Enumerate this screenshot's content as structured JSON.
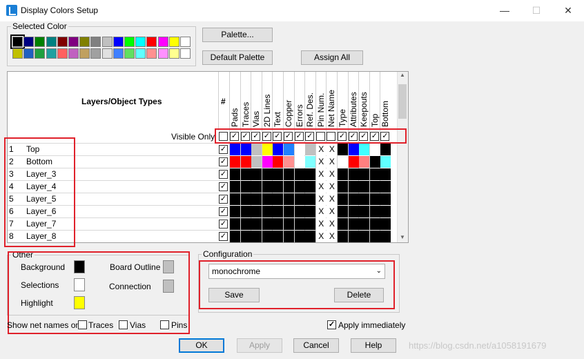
{
  "window": {
    "title": "Display Colors Setup",
    "minimize": "—",
    "maximize": "☐",
    "close": "✕"
  },
  "selected_color": {
    "label": "Selected Color",
    "row1": [
      "#000000",
      "#000080",
      "#008000",
      "#008080",
      "#800000",
      "#800080",
      "#808000",
      "#808080",
      "#c0c0c0",
      "#0000ff",
      "#00ff00",
      "#00ffff",
      "#ff0000",
      "#ff00ff",
      "#ffff00",
      "#ffffff"
    ],
    "row2": [
      "#c0c000",
      "#2060c0",
      "#20a040",
      "#20a0a0",
      "#ff6060",
      "#c060c0",
      "#c0a060",
      "#a0a0a0",
      "#e0e0e0",
      "#4080ff",
      "#60e060",
      "#60ffff",
      "#ff9090",
      "#ff90ff",
      "#ffff90",
      "#ffffff"
    ]
  },
  "buttons": {
    "palette": "Palette...",
    "default_palette": "Default Palette",
    "assign_all": "Assign All",
    "ok": "OK",
    "apply": "Apply",
    "cancel": "Cancel",
    "help": "Help",
    "save": "Save",
    "delete": "Delete"
  },
  "grid": {
    "header_title": "Layers/Object Types",
    "hash": "#",
    "visible_only": "Visible Only",
    "columns": [
      "Pads",
      "Traces",
      "Vias",
      "2D Lines",
      "Text",
      "Copper",
      "Errors",
      "Ref. Des.",
      "Pin Num.",
      "Net Name",
      "Type",
      "Attributes",
      "Keepouts",
      "Top",
      "Bottom"
    ],
    "visible_checks": [
      true,
      true,
      true,
      true,
      true,
      true,
      true,
      true,
      false,
      false,
      true,
      true,
      true,
      true,
      true
    ],
    "rows": [
      {
        "num": "1",
        "name": "Top",
        "colors": [
          "#0000ff",
          "#0000ff",
          "#c0c0c0",
          "#ffff00",
          "#0000ff",
          "#2080ff",
          "#ffffff",
          "#c0c0c0",
          "X",
          "X",
          "#000000",
          "#0000ff",
          "#40ffff",
          "#ffffff",
          "#000000"
        ]
      },
      {
        "num": "2",
        "name": "Bottom",
        "colors": [
          "#ff0000",
          "#ff0000",
          "#c0c0c0",
          "#ff00ff",
          "#ff0000",
          "#ff9090",
          "#ffffff",
          "#80ffff",
          "X",
          "X",
          "#ffffff",
          "#ff0000",
          "#ff8080",
          "#000000",
          "#60ffff"
        ]
      },
      {
        "num": "3",
        "name": "Layer_3",
        "colors": [
          "#000000",
          "#000000",
          "#000000",
          "#000000",
          "#000000",
          "#000000",
          "#000000",
          "#000000",
          "X",
          "X",
          "#000000",
          "#000000",
          "#000000",
          "#000000",
          "#000000"
        ]
      },
      {
        "num": "4",
        "name": "Layer_4",
        "colors": [
          "#000000",
          "#000000",
          "#000000",
          "#000000",
          "#000000",
          "#000000",
          "#000000",
          "#000000",
          "X",
          "X",
          "#000000",
          "#000000",
          "#000000",
          "#000000",
          "#000000"
        ]
      },
      {
        "num": "5",
        "name": "Layer_5",
        "colors": [
          "#000000",
          "#000000",
          "#000000",
          "#000000",
          "#000000",
          "#000000",
          "#000000",
          "#000000",
          "X",
          "X",
          "#000000",
          "#000000",
          "#000000",
          "#000000",
          "#000000"
        ]
      },
      {
        "num": "6",
        "name": "Layer_6",
        "colors": [
          "#000000",
          "#000000",
          "#000000",
          "#000000",
          "#000000",
          "#000000",
          "#000000",
          "#000000",
          "X",
          "X",
          "#000000",
          "#000000",
          "#000000",
          "#000000",
          "#000000"
        ]
      },
      {
        "num": "7",
        "name": "Layer_7",
        "colors": [
          "#000000",
          "#000000",
          "#000000",
          "#000000",
          "#000000",
          "#000000",
          "#000000",
          "#000000",
          "X",
          "X",
          "#000000",
          "#000000",
          "#000000",
          "#000000",
          "#000000"
        ]
      },
      {
        "num": "8",
        "name": "Layer_8",
        "colors": [
          "#000000",
          "#000000",
          "#000000",
          "#000000",
          "#000000",
          "#000000",
          "#000000",
          "#000000",
          "X",
          "X",
          "#000000",
          "#000000",
          "#000000",
          "#000000",
          "#000000"
        ]
      }
    ]
  },
  "other": {
    "label": "Other",
    "background": "Background",
    "background_color": "#000000",
    "selections": "Selections",
    "selections_color": "#ffffff",
    "highlight": "Highlight",
    "highlight_color": "#ffff00",
    "board_outline": "Board Outline",
    "board_outline_color": "#c0c0c0",
    "connection": "Connection",
    "connection_color": "#c0c0c0",
    "show_net_names": "Show net names on",
    "traces": "Traces",
    "vias": "Vias",
    "pins": "Pins"
  },
  "configuration": {
    "label": "Configuration",
    "selected": "monochrome"
  },
  "apply_immediately": "Apply immediately",
  "watermark": "https://blog.csdn.net/a1058191679"
}
